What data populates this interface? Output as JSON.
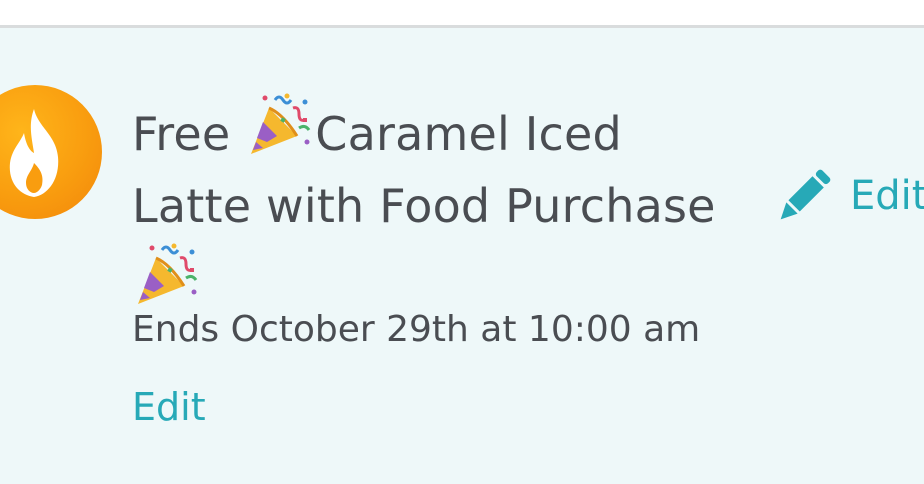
{
  "promo": {
    "title_part1": "Free ",
    "title_part2": "Caramel Iced Latte with Food Purchase",
    "ends": "Ends October 29th at 10:00 am",
    "edit_link": "Edit",
    "edit_action_label": "Edit",
    "badge_icon": "flame-icon",
    "decoration_icon": "party-popper-icon",
    "colors": {
      "background": "#eef8f9",
      "text": "#4a4d52",
      "accent": "#27a9b7",
      "badge": "#f99d0f"
    }
  }
}
